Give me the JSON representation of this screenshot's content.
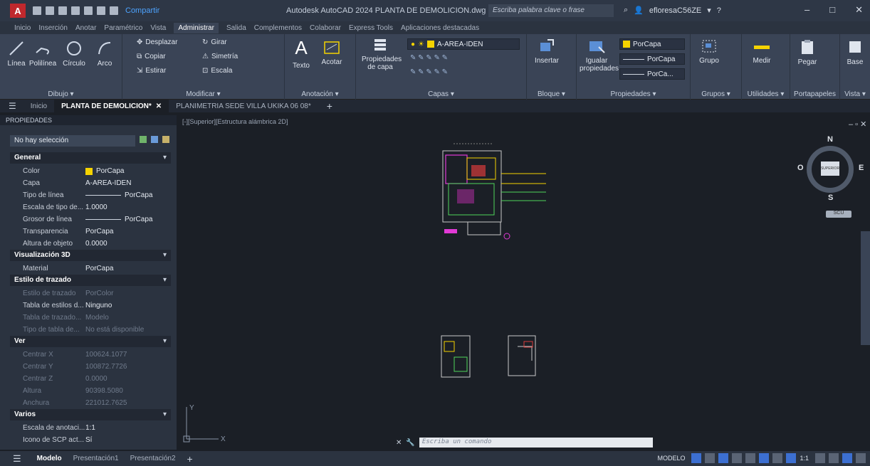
{
  "titlebar": {
    "app_letter": "A",
    "share": "Compartir",
    "title": "Autodesk AutoCAD 2024   PLANTA DE DEMOLICION.dwg",
    "search_placeholder": "Escriba palabra clave o frase",
    "user": "efloresaC56ZE",
    "help": "?"
  },
  "ribbon_tabs": [
    "Inicio",
    "Inserción",
    "Anotar",
    "Paramétrico",
    "Vista",
    "Administrar",
    "Salida",
    "Complementos",
    "Colaborar",
    "Express Tools",
    "Aplicaciones destacadas"
  ],
  "active_ribbon_tab": "Administrar",
  "ribbon": {
    "draw": {
      "title": "Dibujo",
      "tools": [
        "Línea",
        "Polilínea",
        "Círculo",
        "Arco"
      ]
    },
    "modify": {
      "title": "Modificar",
      "tools": [
        "Desplazar",
        "Girar",
        "Copiar",
        "Simetría",
        "Estirar",
        "Escala"
      ]
    },
    "annotation": {
      "title": "Anotación",
      "tools": [
        "Texto",
        "Acotar"
      ]
    },
    "layers": {
      "title": "Capas",
      "props_label": "Propiedades",
      "props_label2": "de capa",
      "current_layer": "A-AREA-IDEN"
    },
    "block": {
      "title": "Bloque",
      "insert": "Insertar"
    },
    "properties": {
      "title": "Propiedades",
      "match": "Igualar",
      "match2": "propiedades",
      "color": "PorCapa",
      "linetype": "PorCapa",
      "lineweight": "PorCa..."
    },
    "groups": {
      "title": "Grupos",
      "group": "Grupo"
    },
    "utilities": {
      "title": "Utilidades",
      "measure": "Medir"
    },
    "clipboard": {
      "title": "Portapapeles",
      "paste": "Pegar"
    },
    "view": {
      "title": "Vista",
      "base": "Base"
    }
  },
  "file_tabs": [
    {
      "label": "Inicio",
      "active": false
    },
    {
      "label": "PLANTA DE DEMOLICION*",
      "active": true
    },
    {
      "label": "PLANIMETRIA SEDE VILLA UKIKA 06 08*",
      "active": false
    }
  ],
  "properties_panel": {
    "title": "PROPIEDADES",
    "selection": "No hay selección",
    "sections": {
      "general": "General",
      "vis3d": "Visualización 3D",
      "plotstyle": "Estilo de trazado",
      "view": "Ver",
      "misc": "Varios"
    },
    "general": [
      {
        "k": "Color",
        "v": "PorCapa"
      },
      {
        "k": "Capa",
        "v": "A-AREA-IDEN"
      },
      {
        "k": "Tipo de línea",
        "v": "PorCapa"
      },
      {
        "k": "Escala de tipo de...",
        "v": "1.0000"
      },
      {
        "k": "Grosor de línea",
        "v": "PorCapa"
      },
      {
        "k": "Transparencia",
        "v": "PorCapa"
      },
      {
        "k": "Altura de objeto",
        "v": "0.0000"
      }
    ],
    "vis3d": [
      {
        "k": "Material",
        "v": "PorCapa"
      }
    ],
    "plotstyle": [
      {
        "k": "Estilo de trazado",
        "v": "PorColor"
      },
      {
        "k": "Tabla de estilos d...",
        "v": "Ninguno"
      },
      {
        "k": "Tabla de trazado...",
        "v": "Modelo"
      },
      {
        "k": "Tipo de tabla de...",
        "v": "No está disponible"
      }
    ],
    "view": [
      {
        "k": "Centrar X",
        "v": "100624.1077"
      },
      {
        "k": "Centrar Y",
        "v": "100872.7726"
      },
      {
        "k": "Centrar Z",
        "v": "0.0000"
      },
      {
        "k": "Altura",
        "v": "90398.5080"
      },
      {
        "k": "Anchura",
        "v": "221012.7625"
      }
    ],
    "misc": [
      {
        "k": "Escala de anotaci...",
        "v": "1:1"
      },
      {
        "k": "Icono de SCP act...",
        "v": "Sí"
      }
    ]
  },
  "viewport": {
    "label": "[-][Superior][Estructura alámbrica 2D]",
    "viewcube": {
      "n": "N",
      "s": "S",
      "e": "E",
      "o": "O",
      "face": "SUPERIOR",
      "wcs": "SCU"
    }
  },
  "command_line": {
    "placeholder": "Escriba un comando"
  },
  "status_bar": {
    "layouts": [
      {
        "label": "Modelo",
        "active": true
      },
      {
        "label": "Presentación1",
        "active": false
      },
      {
        "label": "Presentación2",
        "active": false
      }
    ],
    "mode": "MODELO",
    "scale": "1:1"
  },
  "colors": {
    "accent": "#3c6fd1",
    "layer_color": "#f5d300",
    "app_red": "#c0282d"
  }
}
